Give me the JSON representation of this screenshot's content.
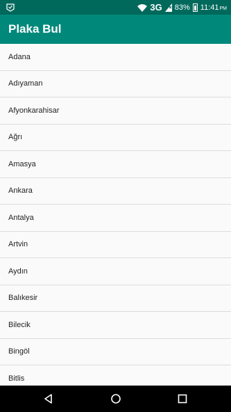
{
  "status_bar": {
    "network": "3G",
    "battery_percent": "83%",
    "time": "11:41",
    "ampm": "PM"
  },
  "app_bar": {
    "title": "Plaka Bul"
  },
  "cities": [
    "Adana",
    "Adıyaman",
    "Afyonkarahisar",
    "Ağrı",
    "Amasya",
    "Ankara",
    "Antalya",
    "Artvin",
    "Aydın",
    "Balıkesir",
    "Bilecik",
    "Bingöl",
    "Bitlis"
  ]
}
